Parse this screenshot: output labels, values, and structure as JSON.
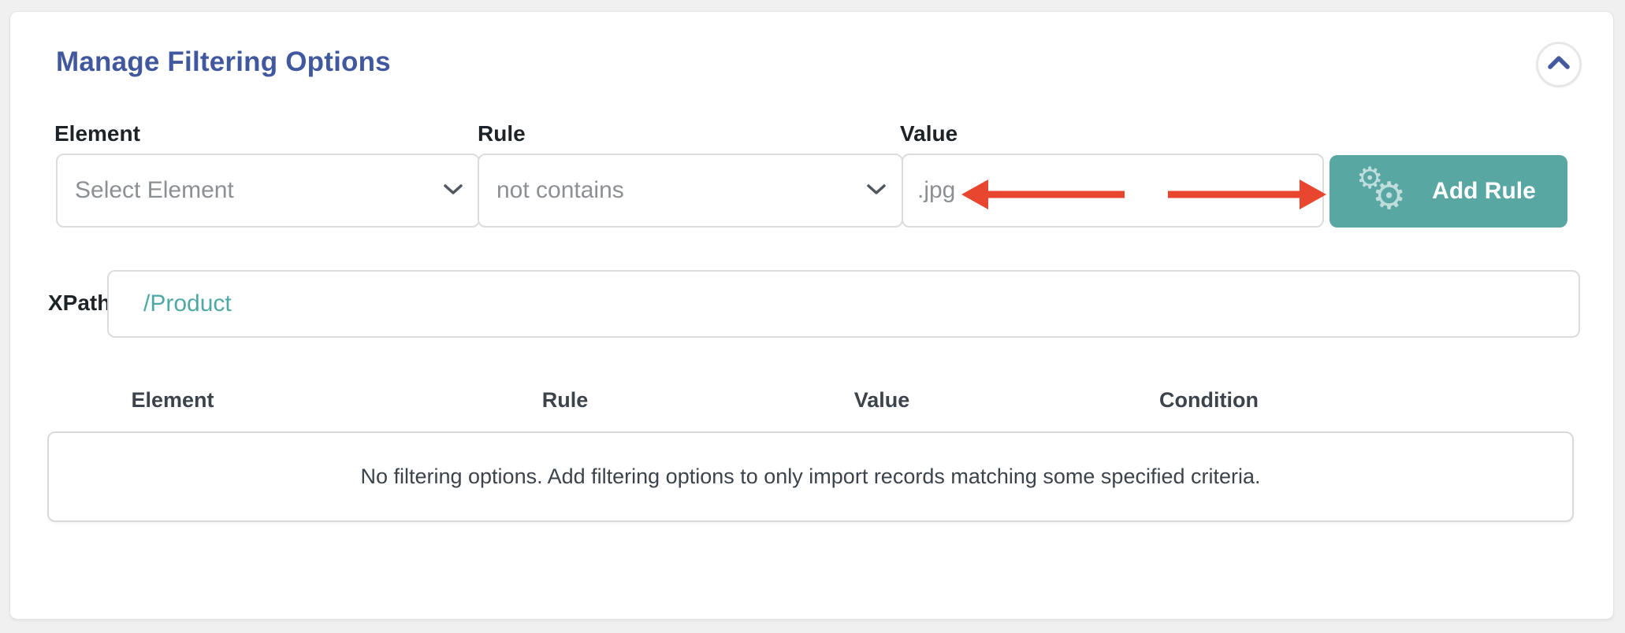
{
  "app": {
    "background_color": "#f0f0f1",
    "accent_blue": "#41589e",
    "accent_teal": "#58a7a2",
    "annotation_red": "#e8462e",
    "muted_text": "#8c8f94"
  },
  "panel": {
    "title": "Manage Filtering Options"
  },
  "filter_form": {
    "element_label": "Element",
    "element_value": "Select Element",
    "rule_label": "Rule",
    "rule_value": "not contains",
    "value_label": "Value",
    "value_text": ".jpg",
    "add_rule_label": "Add Rule"
  },
  "xpath": {
    "label": "XPath",
    "value": "/Product"
  },
  "rules_table": {
    "headers": [
      "Element",
      "Rule",
      "Value",
      "Condition"
    ],
    "empty_message": "No filtering options. Add filtering options to only import records matching some specified criteria."
  },
  "icons": {
    "gear_glyph": "⚙"
  }
}
